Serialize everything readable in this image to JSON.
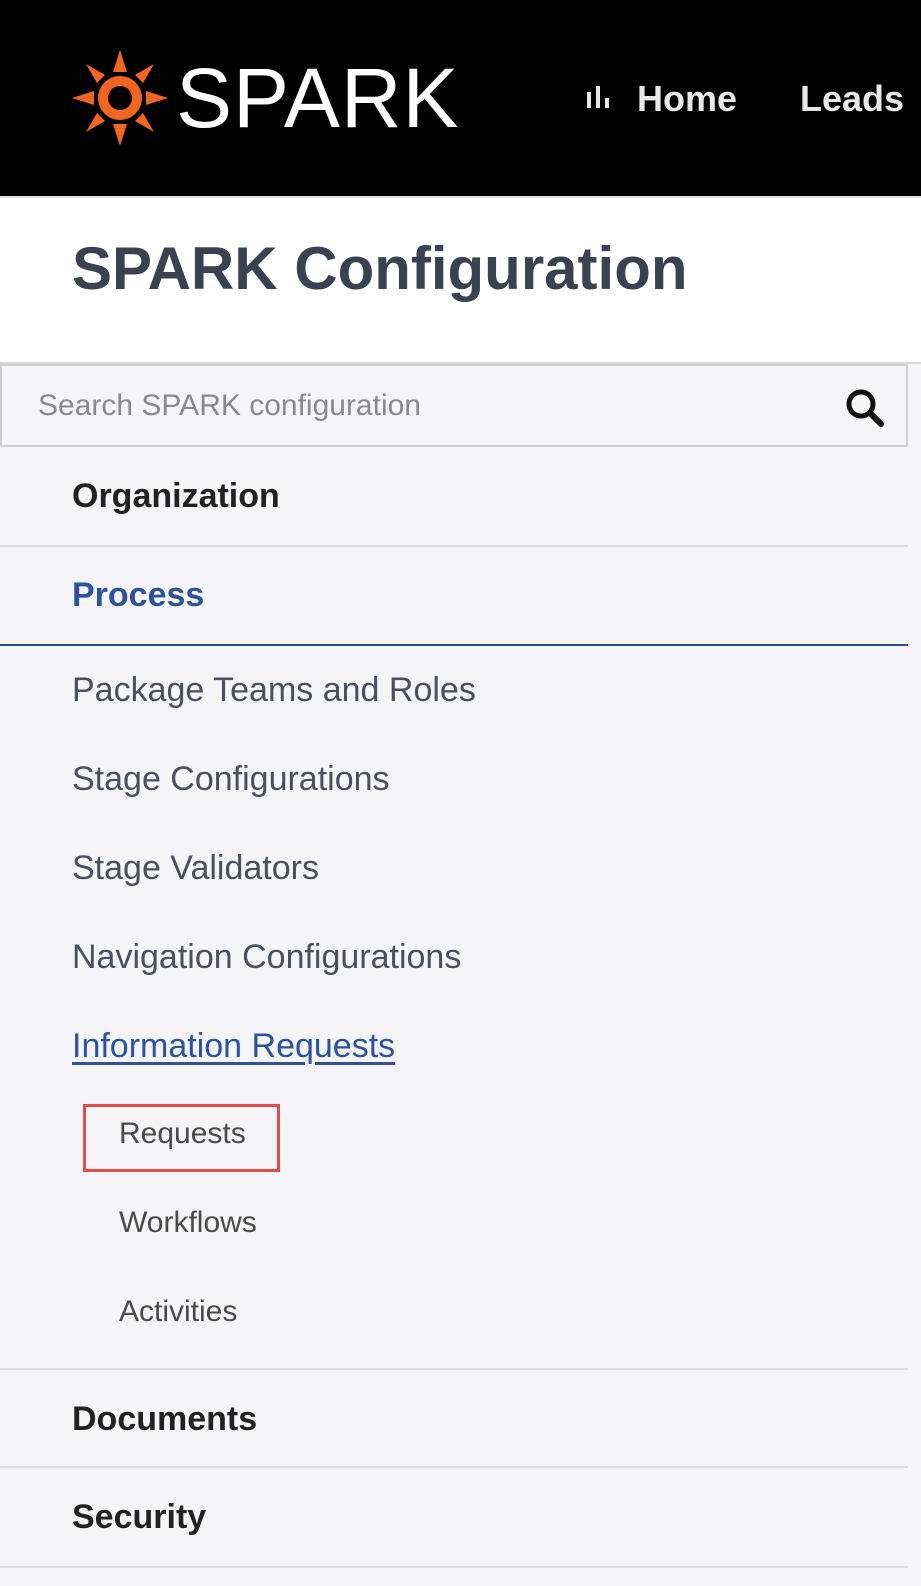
{
  "header": {
    "logo_text": "SPARK",
    "nav": {
      "home_label": "Home",
      "leads_label": "Leads"
    },
    "brand_color": "#f26522"
  },
  "page": {
    "title": "SPARK Configuration"
  },
  "search": {
    "placeholder": "Search SPARK configuration",
    "value": ""
  },
  "sidebar": {
    "sections": [
      {
        "label": "Organization",
        "expanded": false
      },
      {
        "label": "Process",
        "expanded": true,
        "active": true
      },
      {
        "label": "Documents",
        "expanded": false
      },
      {
        "label": "Security",
        "expanded": false
      }
    ],
    "process_items": [
      {
        "label": "Package Teams and Roles"
      },
      {
        "label": "Stage Configurations"
      },
      {
        "label": "Stage Validators"
      },
      {
        "label": "Navigation Configurations"
      },
      {
        "label": "Information Requests",
        "active": true
      }
    ],
    "information_requests_items": [
      {
        "label": "Requests",
        "highlighted": true
      },
      {
        "label": "Workflows"
      },
      {
        "label": "Activities"
      }
    ]
  },
  "colors": {
    "active_link": "#2d52a0",
    "highlight_box": "#e24b4b"
  }
}
